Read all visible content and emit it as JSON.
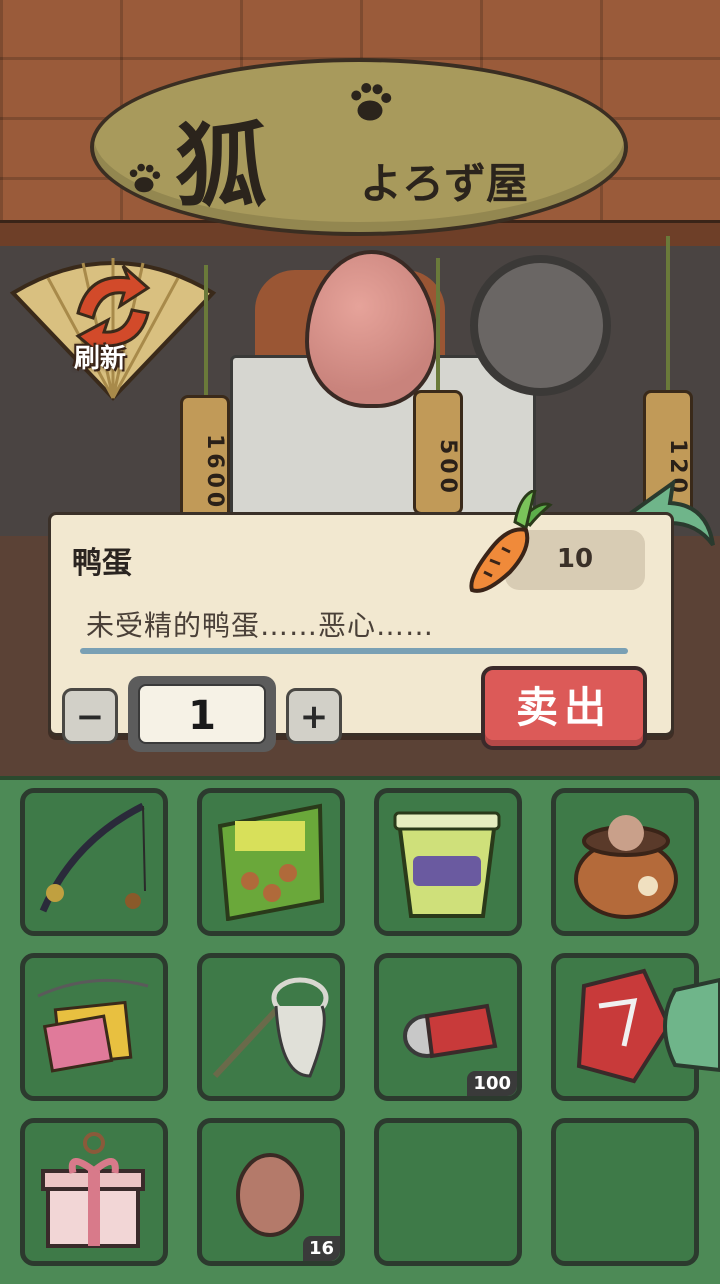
{
  "shop": {
    "sign_title": "狐",
    "sign_subtitle": "よろず屋",
    "refresh_label": "刷新",
    "price_tags": [
      "1600",
      "500",
      "120"
    ]
  },
  "dialog": {
    "item_name": "鸭蛋",
    "price": "10",
    "description": "未受精的鸭蛋……恶心……",
    "quantity": "1",
    "minus_label": "−",
    "plus_label": "+",
    "sell_label": "卖出"
  },
  "inventory": {
    "slots": [
      {
        "item": "fishing-rod",
        "count": ""
      },
      {
        "item": "snack-bag",
        "count": ""
      },
      {
        "item": "cup-noodles",
        "count": ""
      },
      {
        "item": "hamster-pot",
        "count": ""
      },
      {
        "item": "paper-charms",
        "count": ""
      },
      {
        "item": "bug-net",
        "count": ""
      },
      {
        "item": "crushed-can",
        "count": "100"
      },
      {
        "item": "crushed-carton",
        "count": ""
      },
      {
        "item": "gift-box",
        "count": ""
      },
      {
        "item": "egg",
        "count": "16"
      },
      {
        "item": "empty",
        "count": ""
      },
      {
        "item": "empty",
        "count": ""
      }
    ]
  },
  "colors": {
    "sell_button": "#dc5a58",
    "inventory_bg": "#4d8a56",
    "dialog_bg": "#f2e8d0"
  }
}
